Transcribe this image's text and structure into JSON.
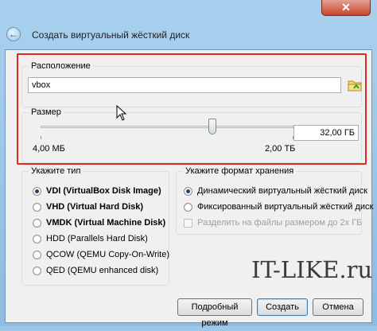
{
  "window": {
    "title": "Создать виртуальный жёсткий диск",
    "close_glyph": "✕",
    "back_glyph": "←"
  },
  "location": {
    "label": "Расположение",
    "value": "vbox",
    "folder_icon": "folder-icon"
  },
  "size": {
    "label": "Размер",
    "slider_position": 0.68,
    "value": "32,00 ГБ",
    "min_label": "4,00 МБ",
    "max_label": "2,00 ТБ"
  },
  "type_group": {
    "label": "Укажите тип",
    "options": [
      {
        "label": "VDI (VirtualBox Disk Image)",
        "checked": true,
        "bold": true
      },
      {
        "label": "VHD (Virtual Hard Disk)",
        "checked": false,
        "bold": true
      },
      {
        "label": "VMDK (Virtual Machine Disk)",
        "checked": false,
        "bold": true
      },
      {
        "label": "HDD (Parallels Hard Disk)",
        "checked": false,
        "bold": false
      },
      {
        "label": "QCOW (QEMU Copy-On-Write)",
        "checked": false,
        "bold": false
      },
      {
        "label": "QED (QEMU enhanced disk)",
        "checked": false,
        "bold": false
      }
    ]
  },
  "format_group": {
    "label": "Укажите формат хранения",
    "options": [
      {
        "label": "Динамический виртуальный жёсткий диск",
        "checked": true
      },
      {
        "label": "Фиксированный виртуальный жёсткий диск",
        "checked": false
      }
    ],
    "split_checkbox": {
      "label": "Разделить на файлы размером до 2х ГБ",
      "checked": false,
      "disabled": true
    }
  },
  "buttons": {
    "expert": "Подробный режим",
    "create": "Создать",
    "cancel": "Отмена"
  },
  "watermark": "IT-LIKE.ru",
  "colors": {
    "highlight": "#e02a20",
    "title_bar": "#a9d1ef"
  }
}
